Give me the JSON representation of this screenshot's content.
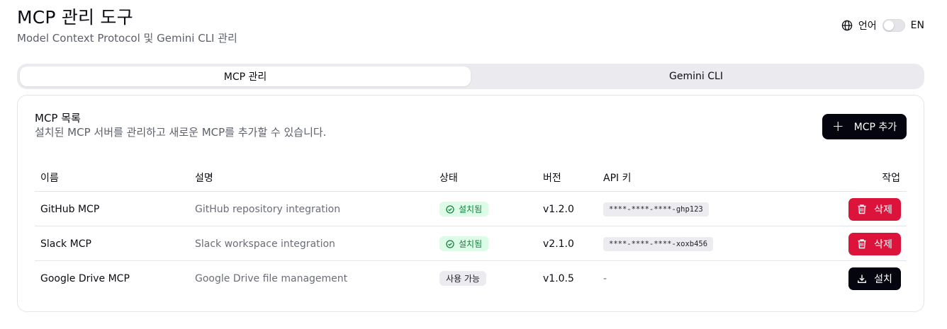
{
  "header": {
    "title": "MCP 관리 도구",
    "subtitle": "Model Context Protocol 및 Gemini CLI 관리"
  },
  "language": {
    "label": "언어",
    "current": "EN",
    "icon": "globe-icon",
    "toggle_on": false
  },
  "tabs": [
    {
      "label": "MCP 관리",
      "active": true
    },
    {
      "label": "Gemini CLI",
      "active": false
    }
  ],
  "card": {
    "title": "MCP 목록",
    "description": "설치된 MCP 서버를 관리하고 새로운 MCP를 추가할 수 있습니다.",
    "add_button": "MCP 추가"
  },
  "table": {
    "headers": [
      "이름",
      "설명",
      "상태",
      "버전",
      "API 키",
      "작업"
    ],
    "rows": [
      {
        "name": "GitHub MCP",
        "description": "GitHub repository integration",
        "status": "설치됨",
        "version": "v1.2.0",
        "api_key": "****-****-****-ghp123",
        "action": "삭제"
      },
      {
        "name": "Slack MCP",
        "description": "Slack workspace integration",
        "status": "설치됨",
        "version": "v2.1.0",
        "api_key": "****-****-****-xoxb456",
        "action": "삭제"
      },
      {
        "name": "Google Drive MCP",
        "description": "Google Drive file management",
        "status": "사용 가능",
        "version": "v1.0.5",
        "api_key": "-",
        "action": "설치"
      }
    ]
  },
  "colors": {
    "primary": "#05050f",
    "danger": "#dc143c",
    "success_bg": "#dcfce7",
    "success_text": "#15803d",
    "muted_bg": "#ececf0",
    "tab_bg": "#ebebef"
  }
}
